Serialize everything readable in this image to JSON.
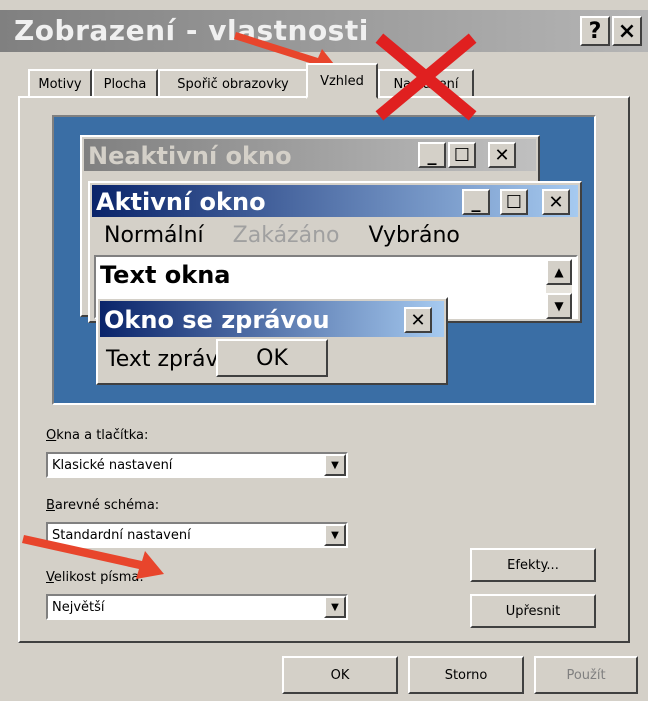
{
  "window": {
    "title": "Zobrazení - vlastnosti",
    "help_label": "?",
    "close_label": "×"
  },
  "tabs": [
    {
      "label": "Motivy"
    },
    {
      "label": "Plocha"
    },
    {
      "label": "Spořič obrazovky"
    },
    {
      "label": "Vzhled"
    },
    {
      "label": "Nastavení"
    }
  ],
  "preview": {
    "inactive_title": "Neaktivní okno",
    "active_title": "Aktivní okno",
    "menu_normal": "Normální",
    "menu_disabled": "Zakázáno",
    "menu_selected": "Vybráno",
    "window_text": "Text okna",
    "message_title": "Okno se zprávou",
    "message_text": "Text zprávy",
    "message_ok": "OK"
  },
  "settings": {
    "windows_buttons_label": "Okna a tlačítka:",
    "windows_buttons_value": "Klasické nastavení",
    "color_scheme_label": "Barevné schéma:",
    "color_scheme_value": "Standardní nastavení",
    "font_size_label": "Velikost písma:",
    "font_size_value": "Největší",
    "effects_button": "Efekty...",
    "advanced_button": "Upřesnit"
  },
  "footer": {
    "ok": "OK",
    "cancel": "Storno",
    "apply": "Použít"
  },
  "annotation_colors": {
    "arrow": "#e8452c",
    "cross": "#e02020"
  }
}
